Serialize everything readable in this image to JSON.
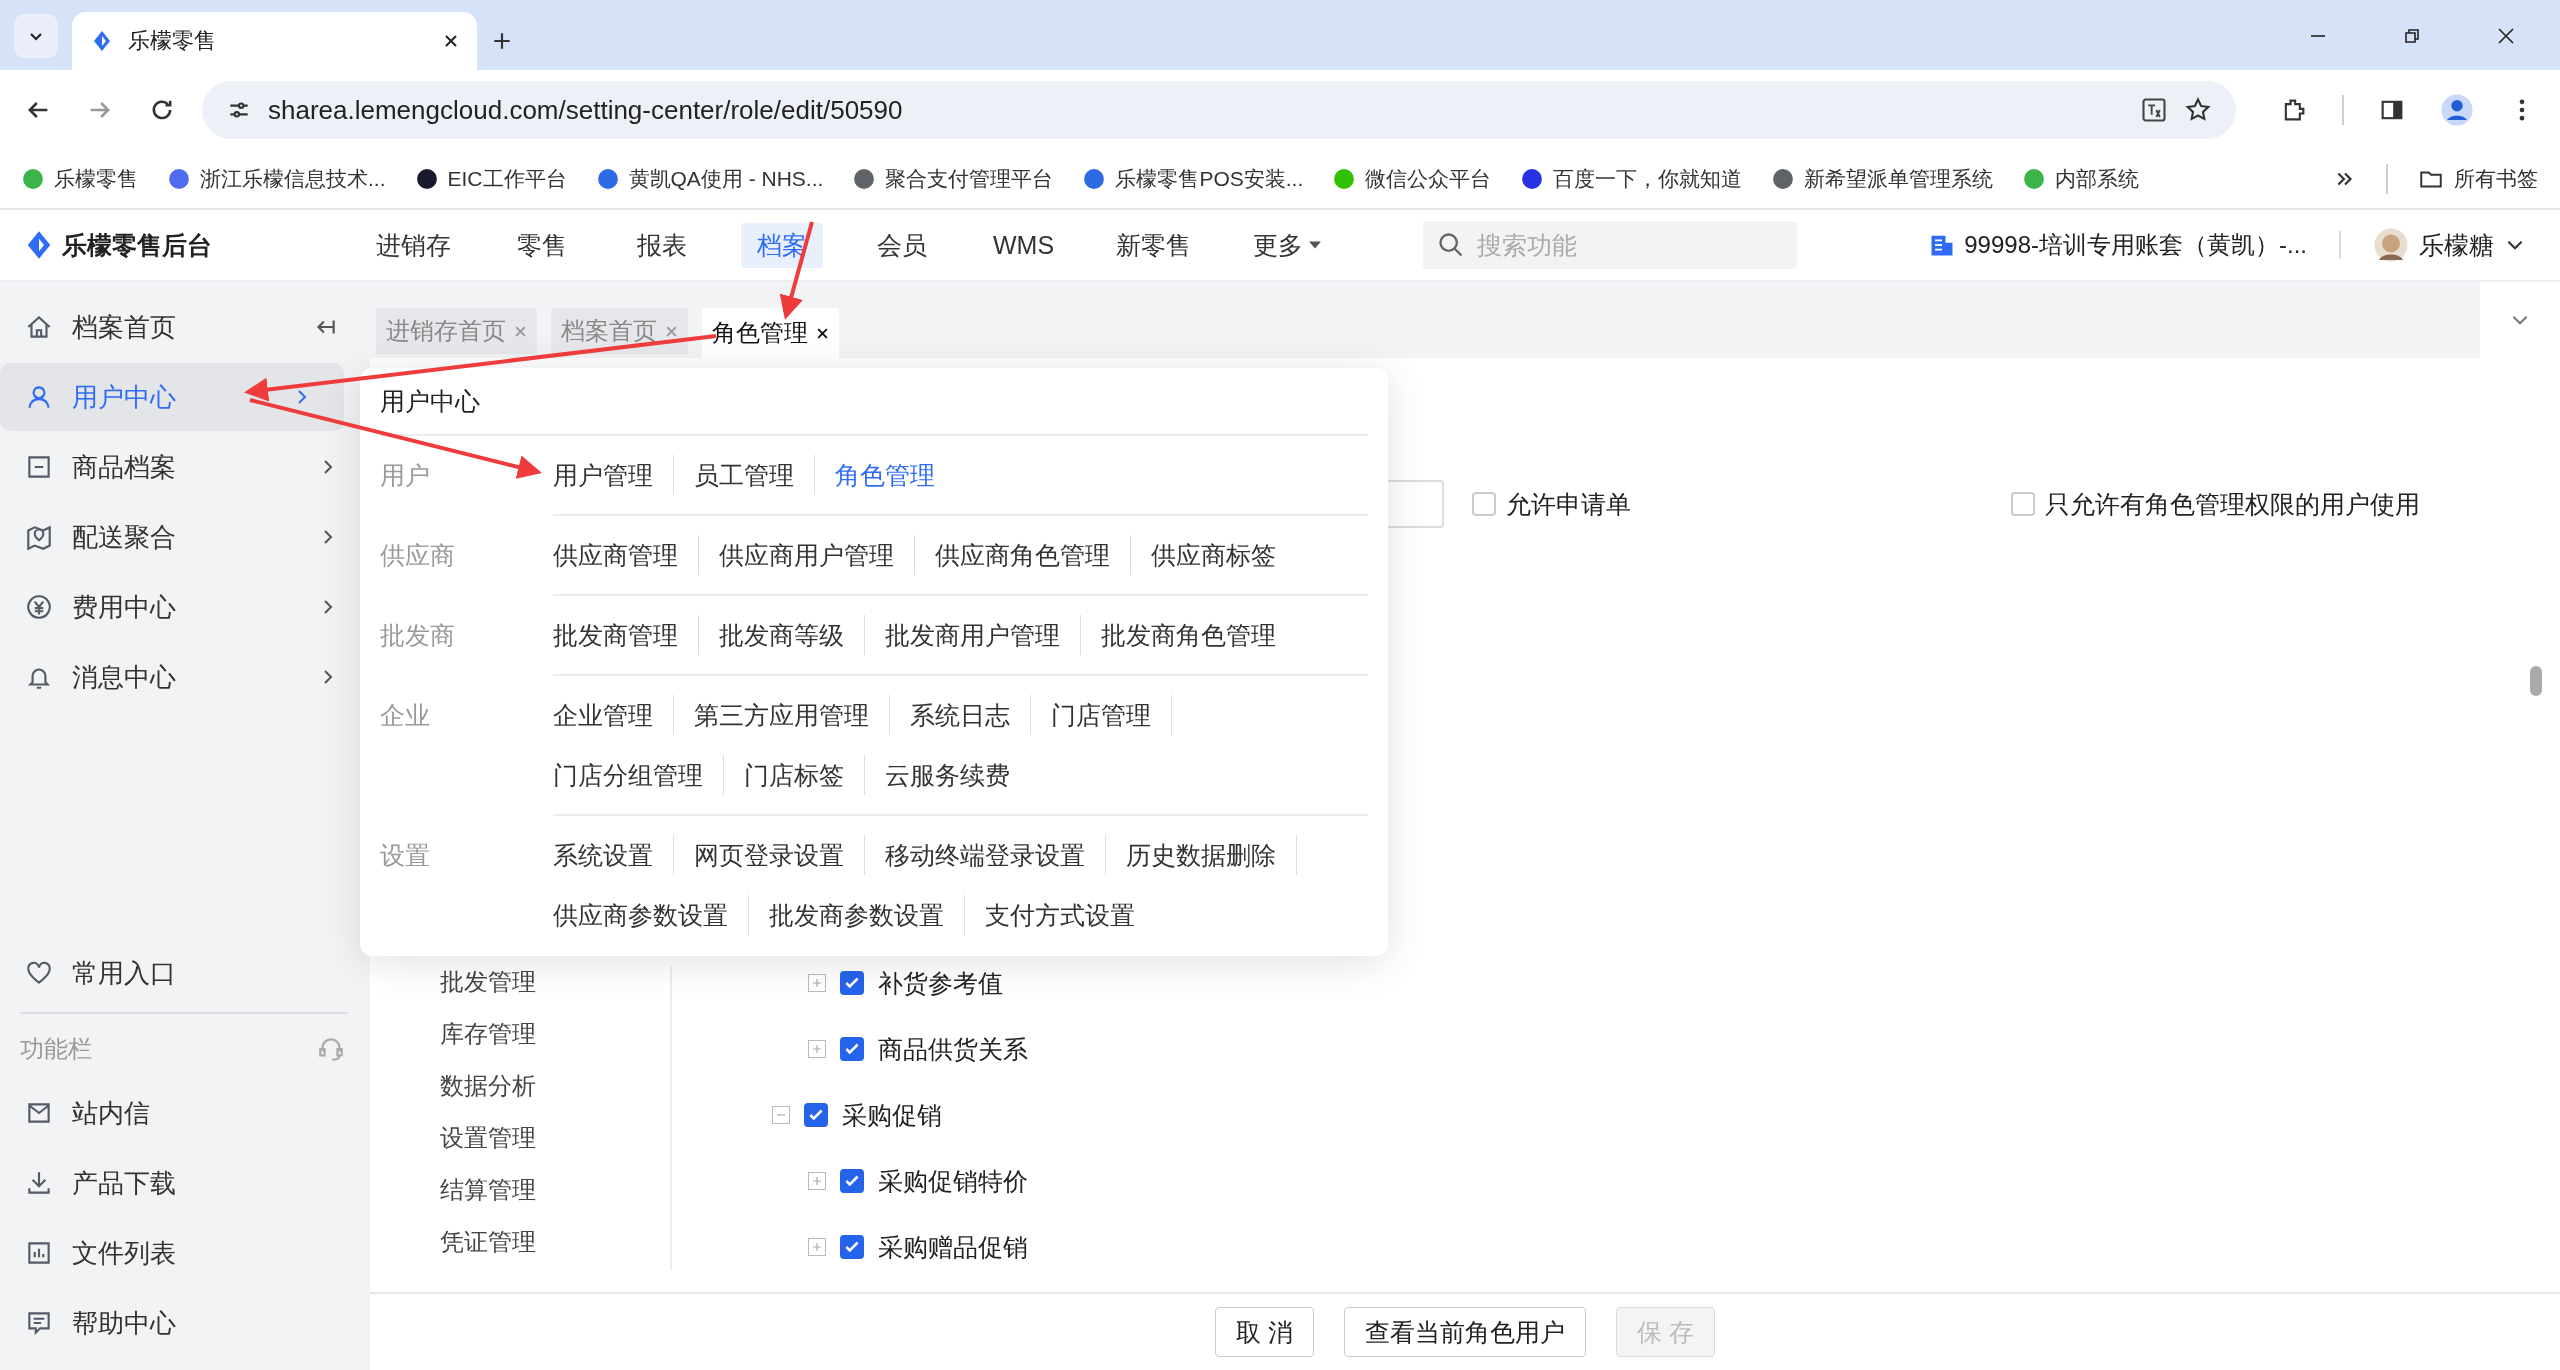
{
  "browser": {
    "tab_title": "乐檬零售",
    "url": "sharea.lemengcloud.com/setting-center/role/edit/50590",
    "bookmarks": [
      {
        "label": "乐檬零售",
        "color": "#3bb54a"
      },
      {
        "label": "浙江乐檬信息技术...",
        "color": "#4f6bf0"
      },
      {
        "label": "EIC工作平台",
        "color": "#1a1a2e"
      },
      {
        "label": "黄凯QA使用 - NHS...",
        "color": "#2d6ae3"
      },
      {
        "label": "聚合支付管理平台",
        "color": "#5f6368"
      },
      {
        "label": "乐檬零售POS安装...",
        "color": "#2d6ae3"
      },
      {
        "label": "微信公众平台",
        "color": "#2dc100"
      },
      {
        "label": "百度一下，你就知道",
        "color": "#2932e1"
      },
      {
        "label": "新希望派单管理系统",
        "color": "#5f6368"
      },
      {
        "label": "内部系统",
        "color": "#3bb54a"
      }
    ],
    "all_bookmarks": "所有书签"
  },
  "header": {
    "logo": "乐檬零售后台",
    "nav": [
      {
        "label": "进销存",
        "selected": false,
        "dropdown": false
      },
      {
        "label": "零售",
        "selected": false,
        "dropdown": false
      },
      {
        "label": "报表",
        "selected": false,
        "dropdown": false
      },
      {
        "label": "档案",
        "selected": true,
        "dropdown": false
      },
      {
        "label": "会员",
        "selected": false,
        "dropdown": false
      },
      {
        "label": "WMS",
        "selected": false,
        "dropdown": false
      },
      {
        "label": "新零售",
        "selected": false,
        "dropdown": false
      },
      {
        "label": "更多",
        "selected": false,
        "dropdown": true
      }
    ],
    "search": {
      "placeholder": "搜索功能"
    },
    "account": "99998-培训专用账套（黄凯）-...",
    "user": "乐檬糖"
  },
  "page_tabs": [
    {
      "label": "进销存首页",
      "selected": false
    },
    {
      "label": "档案首页",
      "selected": false
    },
    {
      "label": "角色管理",
      "selected": true
    }
  ],
  "sidebar": {
    "items": [
      {
        "label": "档案首页",
        "selected": false,
        "has_submenu": false
      },
      {
        "label": "用户中心",
        "selected": true,
        "has_submenu": true
      },
      {
        "label": "商品档案",
        "selected": false,
        "has_submenu": true
      },
      {
        "label": "配送聚合",
        "selected": false,
        "has_submenu": true
      },
      {
        "label": "费用中心",
        "selected": false,
        "has_submenu": true
      },
      {
        "label": "消息中心",
        "selected": false,
        "has_submenu": true
      }
    ],
    "favorites": "常用入口",
    "section": "功能栏",
    "tools": [
      "站内信",
      "产品下载",
      "文件列表",
      "帮助中心"
    ]
  },
  "popup": {
    "title": "用户中心",
    "groups": [
      {
        "label": "用户",
        "links": [
          {
            "label": "用户管理",
            "selected": false
          },
          {
            "label": "员工管理",
            "selected": false
          },
          {
            "label": "角色管理",
            "selected": true
          }
        ]
      },
      {
        "label": "供应商",
        "links": [
          {
            "label": "供应商管理",
            "selected": false
          },
          {
            "label": "供应商用户管理",
            "selected": false
          },
          {
            "label": "供应商角色管理",
            "selected": false
          },
          {
            "label": "供应商标签",
            "selected": false
          }
        ]
      },
      {
        "label": "批发商",
        "links": [
          {
            "label": "批发商管理",
            "selected": false
          },
          {
            "label": "批发商等级",
            "selected": false
          },
          {
            "label": "批发商用户管理",
            "selected": false
          },
          {
            "label": "批发商角色管理",
            "selected": false
          }
        ]
      },
      {
        "label": "企业",
        "links": [
          {
            "label": "企业管理",
            "selected": false
          },
          {
            "label": "第三方应用管理",
            "selected": false
          },
          {
            "label": "系统日志",
            "selected": false
          },
          {
            "label": "门店管理",
            "selected": false
          },
          {
            "label": "门店分组管理",
            "selected": false
          },
          {
            "label": "门店标签",
            "selected": false
          },
          {
            "label": "云服务续费",
            "selected": false
          }
        ]
      },
      {
        "label": "设置",
        "links": [
          {
            "label": "系统设置",
            "selected": false
          },
          {
            "label": "网页登录设置",
            "selected": false
          },
          {
            "label": "移动终端登录设置",
            "selected": false
          },
          {
            "label": "历史数据删除",
            "selected": false
          },
          {
            "label": "供应商参数设置",
            "selected": false
          },
          {
            "label": "批发商参数设置",
            "selected": false
          },
          {
            "label": "支付方式设置",
            "selected": false
          }
        ]
      }
    ]
  },
  "options": [
    {
      "label": "允许申请单",
      "checked": false
    },
    {
      "label": "只允许有角色管理权限的用户使用",
      "checked": false
    }
  ],
  "modules": [
    "批发管理",
    "库存管理",
    "数据分析",
    "设置管理",
    "结算管理",
    "凭证管理"
  ],
  "tree": [
    {
      "children": [
        {
          "label": "补货参考值",
          "checked": true,
          "expanded": false
        },
        {
          "label": "商品供货关系",
          "checked": true,
          "expanded": false
        }
      ]
    },
    {
      "label": "采购促销",
      "checked": true,
      "expanded": true,
      "children": [
        {
          "label": "采购促销特价",
          "checked": true,
          "expanded": false
        },
        {
          "label": "采购赠品促销",
          "checked": true,
          "expanded": false
        }
      ]
    }
  ],
  "footer_buttons": [
    {
      "label": "取 消",
      "disabled": false
    },
    {
      "label": "查看当前角色用户",
      "disabled": false
    },
    {
      "label": "保 存",
      "disabled": true
    }
  ]
}
